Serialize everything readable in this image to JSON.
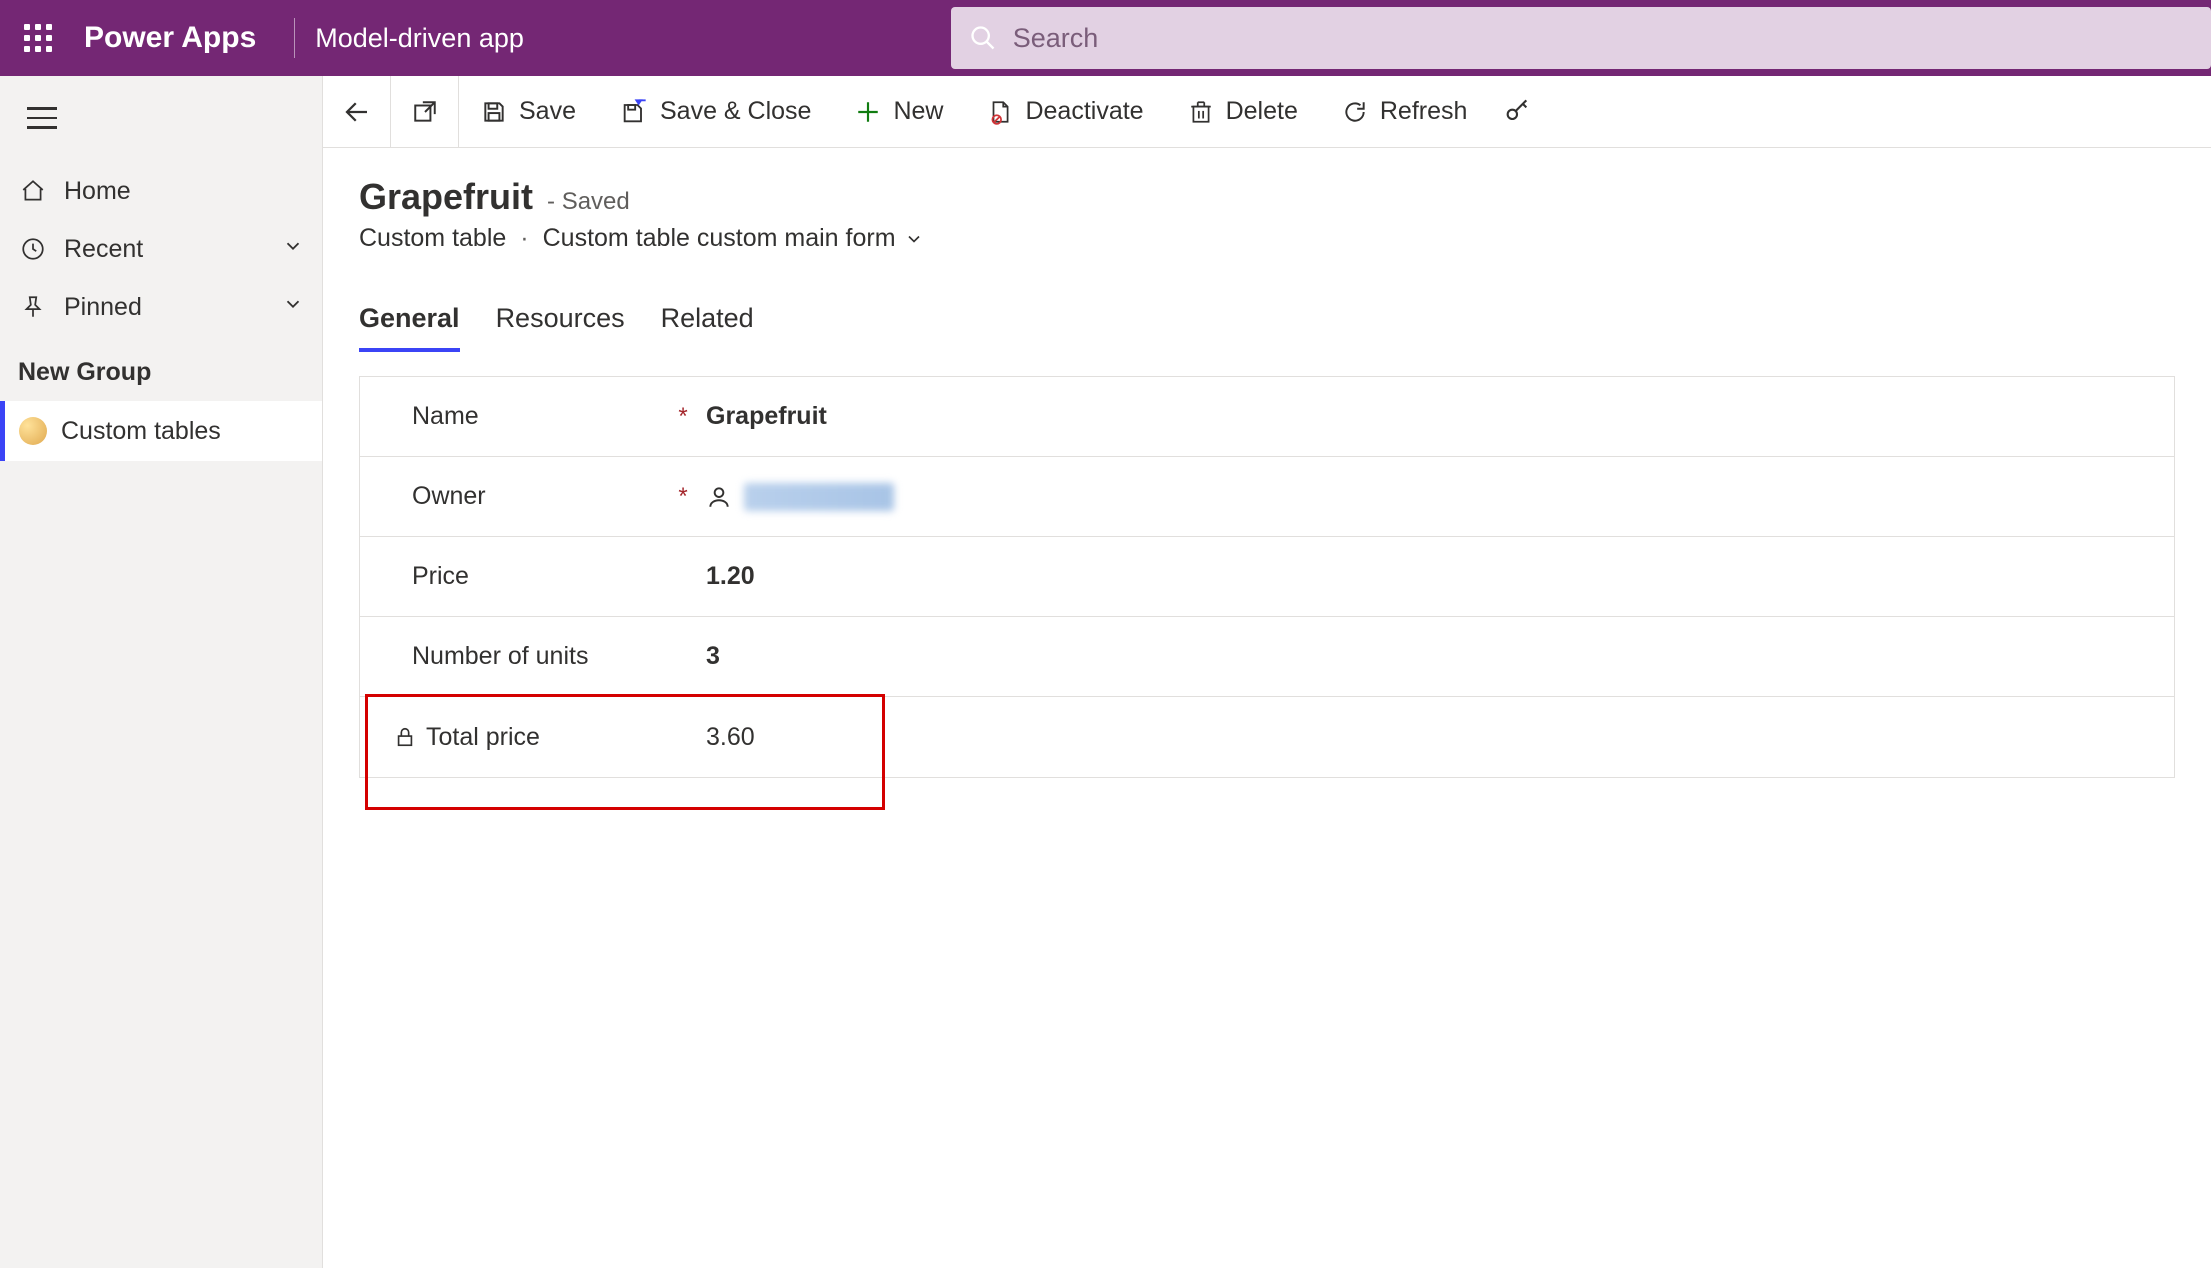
{
  "header": {
    "brand": "Power Apps",
    "app_name": "Model-driven app",
    "search_placeholder": "Search"
  },
  "nav": {
    "home": "Home",
    "recent": "Recent",
    "pinned": "Pinned",
    "group_label": "New Group",
    "subitem": "Custom tables"
  },
  "commands": {
    "save": "Save",
    "save_close": "Save & Close",
    "new": "New",
    "deactivate": "Deactivate",
    "delete": "Delete",
    "refresh": "Refresh"
  },
  "record": {
    "title": "Grapefruit",
    "status": "- Saved",
    "entity": "Custom table",
    "form_name": "Custom table custom main form"
  },
  "tabs": {
    "general": "General",
    "resources": "Resources",
    "related": "Related"
  },
  "fields": {
    "name_label": "Name",
    "name_value": "Grapefruit",
    "owner_label": "Owner",
    "price_label": "Price",
    "price_value": "1.20",
    "units_label": "Number of units",
    "units_value": "3",
    "total_label": "Total price",
    "total_value": "3.60"
  }
}
